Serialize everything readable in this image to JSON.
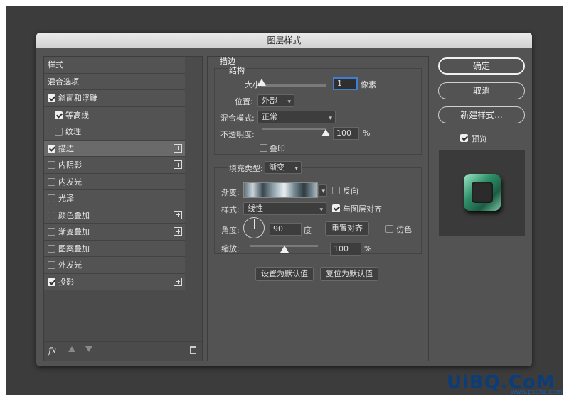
{
  "dialog": {
    "title": "图层样式"
  },
  "styles_header": "样式",
  "style_list": [
    {
      "label": "混合选项",
      "checkbox": false,
      "checked": false,
      "plus": false,
      "indent": false
    },
    {
      "label": "斜面和浮雕",
      "checkbox": true,
      "checked": true,
      "plus": false,
      "indent": false
    },
    {
      "label": "等高线",
      "checkbox": true,
      "checked": true,
      "plus": false,
      "indent": true
    },
    {
      "label": "纹理",
      "checkbox": true,
      "checked": false,
      "plus": false,
      "indent": true
    },
    {
      "label": "描边",
      "checkbox": true,
      "checked": true,
      "plus": true,
      "indent": false,
      "selected": true
    },
    {
      "label": "内阴影",
      "checkbox": true,
      "checked": false,
      "plus": true,
      "indent": false
    },
    {
      "label": "内发光",
      "checkbox": true,
      "checked": false,
      "plus": false,
      "indent": false
    },
    {
      "label": "光泽",
      "checkbox": true,
      "checked": false,
      "plus": false,
      "indent": false
    },
    {
      "label": "颜色叠加",
      "checkbox": true,
      "checked": false,
      "plus": true,
      "indent": false
    },
    {
      "label": "渐变叠加",
      "checkbox": true,
      "checked": false,
      "plus": true,
      "indent": false
    },
    {
      "label": "图案叠加",
      "checkbox": true,
      "checked": false,
      "plus": false,
      "indent": false
    },
    {
      "label": "外发光",
      "checkbox": true,
      "checked": false,
      "plus": false,
      "indent": false
    },
    {
      "label": "投影",
      "checkbox": true,
      "checked": true,
      "plus": true,
      "indent": false
    }
  ],
  "left_bottom": {
    "fx": "fx"
  },
  "stroke": {
    "section_title": "描边",
    "structure_title": "结构",
    "size_label": "大小:",
    "size_value": "1",
    "size_unit": "像素",
    "position_label": "位置:",
    "position_value": "外部",
    "blend_label": "混合模式:",
    "blend_value": "正常",
    "opacity_label": "不透明度:",
    "opacity_value": "100",
    "opacity_unit": "%",
    "opacity_level": 1.0,
    "size_level": 0.0,
    "overprint_label": "叠印",
    "fill_type_label": "填充类型:",
    "fill_type_value": "渐变",
    "gradient_label": "渐变:",
    "reverse_label": "反向",
    "style_label": "样式:",
    "style_value": "线性",
    "align_label": "与图层对齐",
    "angle_label": "角度:",
    "angle_value": "90",
    "angle_unit": "度",
    "reset_align_label": "重置对齐",
    "dither_label": "仿色",
    "scale_label": "缩放:",
    "scale_value": "100",
    "scale_unit": "%",
    "scale_level": 0.5,
    "make_default": "设置为默认值",
    "reset_default": "复位为默认值"
  },
  "right": {
    "ok": "确定",
    "cancel": "取消",
    "new_style": "新建样式...",
    "preview_label": "预览"
  },
  "watermark": {
    "text": "UiBQ.CoM",
    "sub": "www.psahz.com"
  }
}
